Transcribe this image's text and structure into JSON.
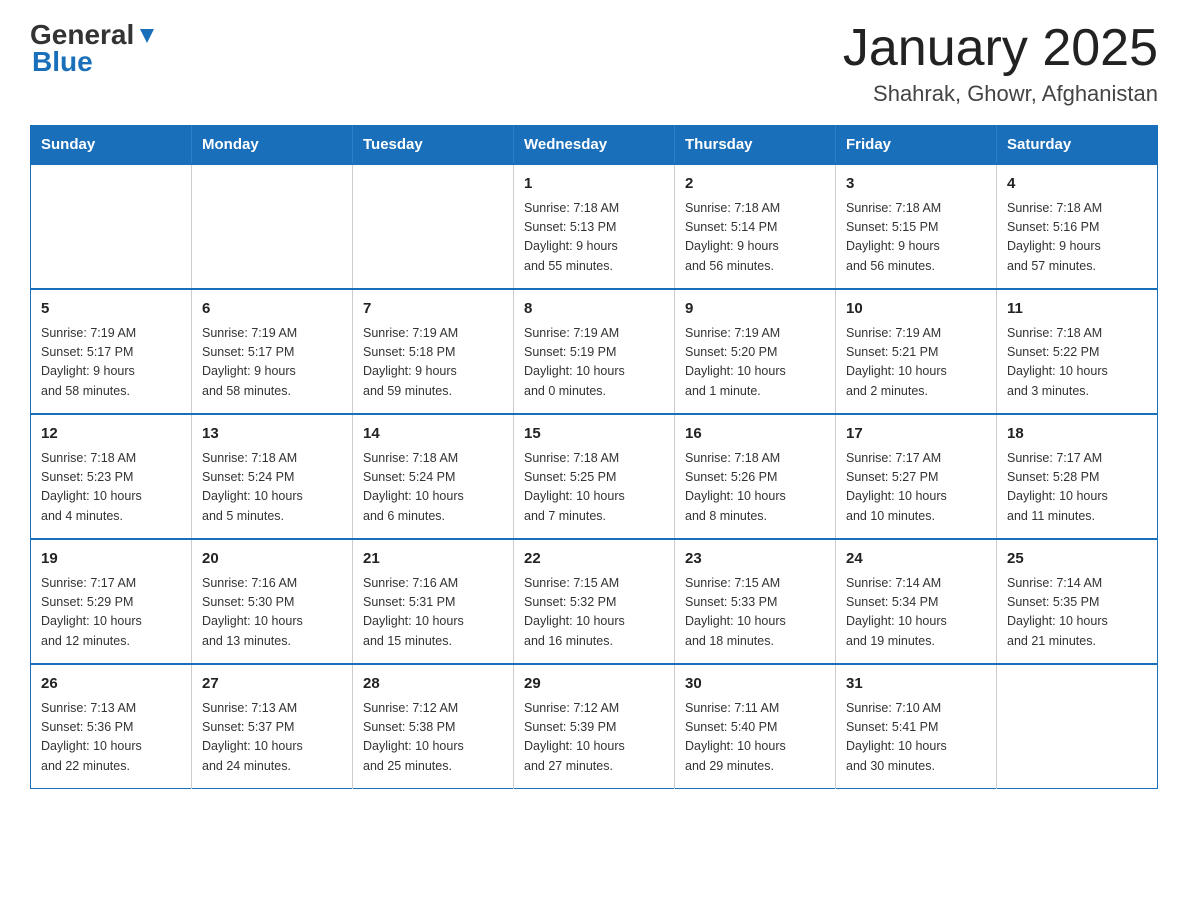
{
  "header": {
    "logo_general": "General",
    "logo_blue": "Blue",
    "title": "January 2025",
    "subtitle": "Shahrak, Ghowr, Afghanistan"
  },
  "days_of_week": [
    "Sunday",
    "Monday",
    "Tuesday",
    "Wednesday",
    "Thursday",
    "Friday",
    "Saturday"
  ],
  "weeks": [
    [
      {
        "day": "",
        "info": ""
      },
      {
        "day": "",
        "info": ""
      },
      {
        "day": "",
        "info": ""
      },
      {
        "day": "1",
        "info": "Sunrise: 7:18 AM\nSunset: 5:13 PM\nDaylight: 9 hours\nand 55 minutes."
      },
      {
        "day": "2",
        "info": "Sunrise: 7:18 AM\nSunset: 5:14 PM\nDaylight: 9 hours\nand 56 minutes."
      },
      {
        "day": "3",
        "info": "Sunrise: 7:18 AM\nSunset: 5:15 PM\nDaylight: 9 hours\nand 56 minutes."
      },
      {
        "day": "4",
        "info": "Sunrise: 7:18 AM\nSunset: 5:16 PM\nDaylight: 9 hours\nand 57 minutes."
      }
    ],
    [
      {
        "day": "5",
        "info": "Sunrise: 7:19 AM\nSunset: 5:17 PM\nDaylight: 9 hours\nand 58 minutes."
      },
      {
        "day": "6",
        "info": "Sunrise: 7:19 AM\nSunset: 5:17 PM\nDaylight: 9 hours\nand 58 minutes."
      },
      {
        "day": "7",
        "info": "Sunrise: 7:19 AM\nSunset: 5:18 PM\nDaylight: 9 hours\nand 59 minutes."
      },
      {
        "day": "8",
        "info": "Sunrise: 7:19 AM\nSunset: 5:19 PM\nDaylight: 10 hours\nand 0 minutes."
      },
      {
        "day": "9",
        "info": "Sunrise: 7:19 AM\nSunset: 5:20 PM\nDaylight: 10 hours\nand 1 minute."
      },
      {
        "day": "10",
        "info": "Sunrise: 7:19 AM\nSunset: 5:21 PM\nDaylight: 10 hours\nand 2 minutes."
      },
      {
        "day": "11",
        "info": "Sunrise: 7:18 AM\nSunset: 5:22 PM\nDaylight: 10 hours\nand 3 minutes."
      }
    ],
    [
      {
        "day": "12",
        "info": "Sunrise: 7:18 AM\nSunset: 5:23 PM\nDaylight: 10 hours\nand 4 minutes."
      },
      {
        "day": "13",
        "info": "Sunrise: 7:18 AM\nSunset: 5:24 PM\nDaylight: 10 hours\nand 5 minutes."
      },
      {
        "day": "14",
        "info": "Sunrise: 7:18 AM\nSunset: 5:24 PM\nDaylight: 10 hours\nand 6 minutes."
      },
      {
        "day": "15",
        "info": "Sunrise: 7:18 AM\nSunset: 5:25 PM\nDaylight: 10 hours\nand 7 minutes."
      },
      {
        "day": "16",
        "info": "Sunrise: 7:18 AM\nSunset: 5:26 PM\nDaylight: 10 hours\nand 8 minutes."
      },
      {
        "day": "17",
        "info": "Sunrise: 7:17 AM\nSunset: 5:27 PM\nDaylight: 10 hours\nand 10 minutes."
      },
      {
        "day": "18",
        "info": "Sunrise: 7:17 AM\nSunset: 5:28 PM\nDaylight: 10 hours\nand 11 minutes."
      }
    ],
    [
      {
        "day": "19",
        "info": "Sunrise: 7:17 AM\nSunset: 5:29 PM\nDaylight: 10 hours\nand 12 minutes."
      },
      {
        "day": "20",
        "info": "Sunrise: 7:16 AM\nSunset: 5:30 PM\nDaylight: 10 hours\nand 13 minutes."
      },
      {
        "day": "21",
        "info": "Sunrise: 7:16 AM\nSunset: 5:31 PM\nDaylight: 10 hours\nand 15 minutes."
      },
      {
        "day": "22",
        "info": "Sunrise: 7:15 AM\nSunset: 5:32 PM\nDaylight: 10 hours\nand 16 minutes."
      },
      {
        "day": "23",
        "info": "Sunrise: 7:15 AM\nSunset: 5:33 PM\nDaylight: 10 hours\nand 18 minutes."
      },
      {
        "day": "24",
        "info": "Sunrise: 7:14 AM\nSunset: 5:34 PM\nDaylight: 10 hours\nand 19 minutes."
      },
      {
        "day": "25",
        "info": "Sunrise: 7:14 AM\nSunset: 5:35 PM\nDaylight: 10 hours\nand 21 minutes."
      }
    ],
    [
      {
        "day": "26",
        "info": "Sunrise: 7:13 AM\nSunset: 5:36 PM\nDaylight: 10 hours\nand 22 minutes."
      },
      {
        "day": "27",
        "info": "Sunrise: 7:13 AM\nSunset: 5:37 PM\nDaylight: 10 hours\nand 24 minutes."
      },
      {
        "day": "28",
        "info": "Sunrise: 7:12 AM\nSunset: 5:38 PM\nDaylight: 10 hours\nand 25 minutes."
      },
      {
        "day": "29",
        "info": "Sunrise: 7:12 AM\nSunset: 5:39 PM\nDaylight: 10 hours\nand 27 minutes."
      },
      {
        "day": "30",
        "info": "Sunrise: 7:11 AM\nSunset: 5:40 PM\nDaylight: 10 hours\nand 29 minutes."
      },
      {
        "day": "31",
        "info": "Sunrise: 7:10 AM\nSunset: 5:41 PM\nDaylight: 10 hours\nand 30 minutes."
      },
      {
        "day": "",
        "info": ""
      }
    ]
  ]
}
